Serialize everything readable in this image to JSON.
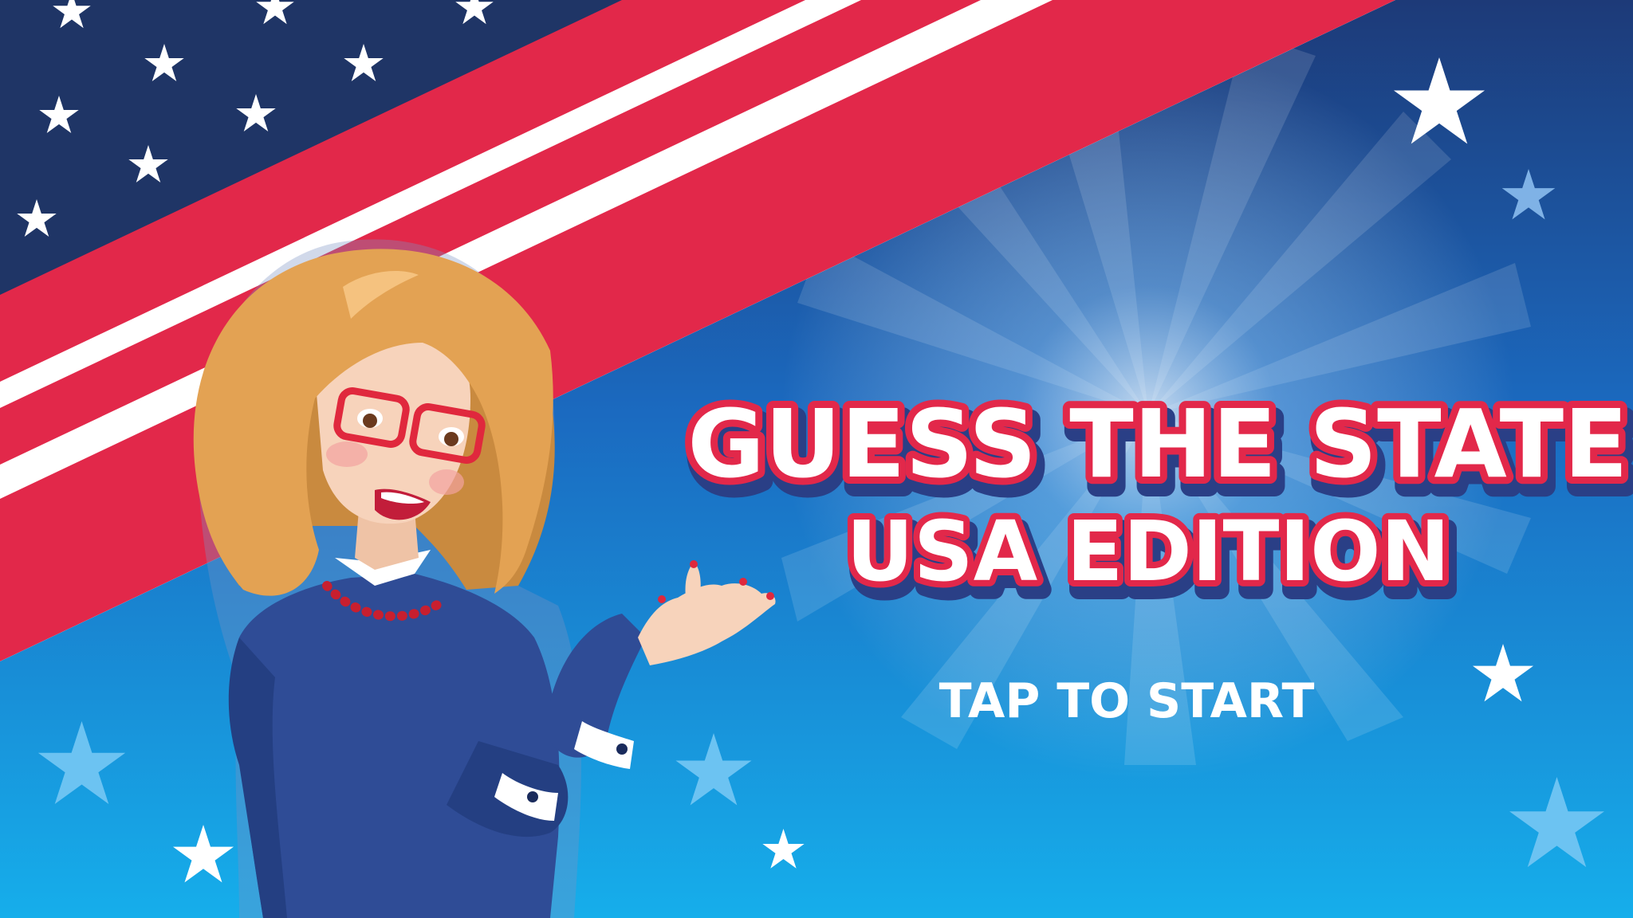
{
  "game": {
    "title_line1": "GUESS THE STATE",
    "title_line2": "USA EDITION",
    "start_prompt": "TAP TO START"
  },
  "colors": {
    "background_top": "#1c3f7a",
    "background_bottom": "#17a8e8",
    "flag_red": "#e2284a",
    "flag_white": "#ffffff",
    "flag_blue": "#1f3566",
    "title_fill": "#ffffff",
    "title_outline": "#e2284a",
    "title_shadow": "#2a3f86",
    "hair": "#e3a253",
    "dress": "#2f4c96",
    "skin": "#f7d3bb",
    "glasses": "#e0283d"
  },
  "icons": {
    "decor": "star-icon",
    "mascot": "host-character"
  }
}
